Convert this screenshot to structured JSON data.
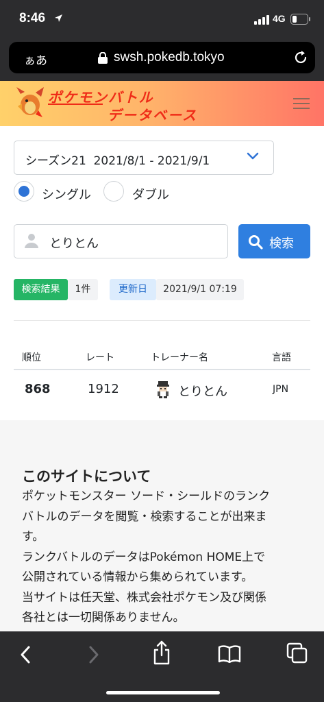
{
  "status_bar": {
    "time": "8:46",
    "network": "4G"
  },
  "browser": {
    "aa_label": "ぁあ",
    "url": "swsh.pokedb.tokyo"
  },
  "site": {
    "logo_line1": "ポケモンバトル",
    "logo_line2": "データベース",
    "gradient_colors": [
      "#ffd16a",
      "#ff7466"
    ]
  },
  "filters": {
    "season_selected": "シーズン21  2021/8/1 - 2021/9/1",
    "battle_modes": [
      {
        "label": "シングル",
        "selected": true
      },
      {
        "label": "ダブル",
        "selected": false
      }
    ]
  },
  "search": {
    "value": "とりとん",
    "button_label": "検索"
  },
  "results": {
    "label": "検索結果",
    "count": "1件",
    "updated_label": "更新日",
    "updated_value": "2021/9/1 07:19"
  },
  "table": {
    "headers": [
      "順位",
      "レート",
      "トレーナー名",
      "言語"
    ],
    "rows": [
      {
        "rank": "868",
        "rate": "1912",
        "trainer": "とりとん",
        "language": "JPN"
      }
    ]
  },
  "about": {
    "title": "このサイトについて",
    "lines": [
      "ポケットモンスター ソード・シールドのランク",
      "バトルのデータを閲覧・検索することが出来ま",
      "す。",
      "ランクバトルのデータはPokémon HOME上で",
      "公開されている情報から集められています。",
      "当サイトは任天堂、株式会社ポケモン及び関係",
      "各社とは一切関係ありません。"
    ]
  },
  "colors": {
    "primary": "#2f7fe0",
    "success": "#25b565",
    "accent_red": "#ef2c18"
  }
}
